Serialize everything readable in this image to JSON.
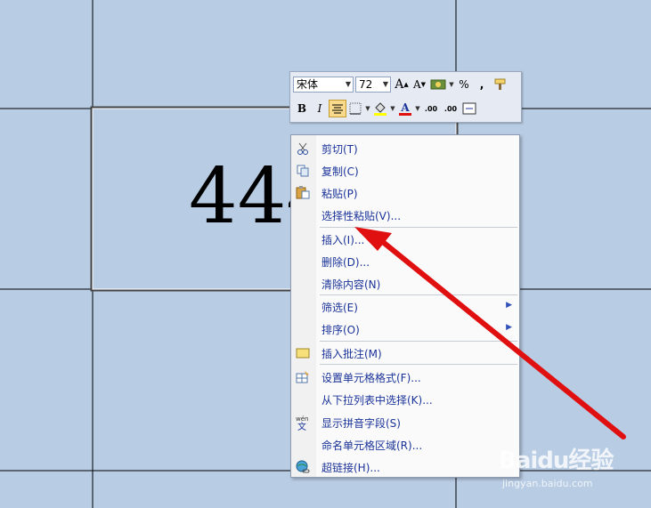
{
  "sheet": {
    "cell_value": "444"
  },
  "mini_toolbar": {
    "font_name": "宋体",
    "font_size": "72",
    "grow_font_label": "A",
    "shrink_font_label": "A",
    "percent_label": "%",
    "comma_label": ",",
    "bold_label": "B",
    "italic_label": "I",
    "font_color_label": "A",
    "inc_decimal_label": ".00",
    "dec_decimal_label": ".00"
  },
  "context_menu": {
    "items": [
      {
        "label": "剪切(T)",
        "icon": "scissors-icon"
      },
      {
        "label": "复制(C)",
        "icon": "copy-icon"
      },
      {
        "label": "粘贴(P)",
        "icon": "paste-icon"
      },
      {
        "label": "选择性粘贴(V)...",
        "icon": ""
      },
      {
        "label": "插入(I)...",
        "icon": ""
      },
      {
        "label": "删除(D)...",
        "icon": ""
      },
      {
        "label": "清除内容(N)",
        "icon": ""
      },
      {
        "label": "筛选(E)",
        "icon": "",
        "submenu": true
      },
      {
        "label": "排序(O)",
        "icon": "",
        "submenu": true
      },
      {
        "label": "插入批注(M)",
        "icon": "comment-icon"
      },
      {
        "label": "设置单元格格式(F)...",
        "icon": "format-cells-icon"
      },
      {
        "label": "从下拉列表中选择(K)...",
        "icon": ""
      },
      {
        "label": "显示拼音字段(S)",
        "icon": "phonetic-icon"
      },
      {
        "label": "命名单元格区域(R)...",
        "icon": ""
      },
      {
        "label": "超链接(H)...",
        "icon": "hyperlink-icon"
      }
    ]
  },
  "colors": {
    "sheet_bg": "#b8cce4",
    "menu_text": "#1a3399",
    "arrow": "#e01010"
  },
  "watermark": {
    "logo": "Baidu经验",
    "url": "jingyan.baidu.com"
  }
}
